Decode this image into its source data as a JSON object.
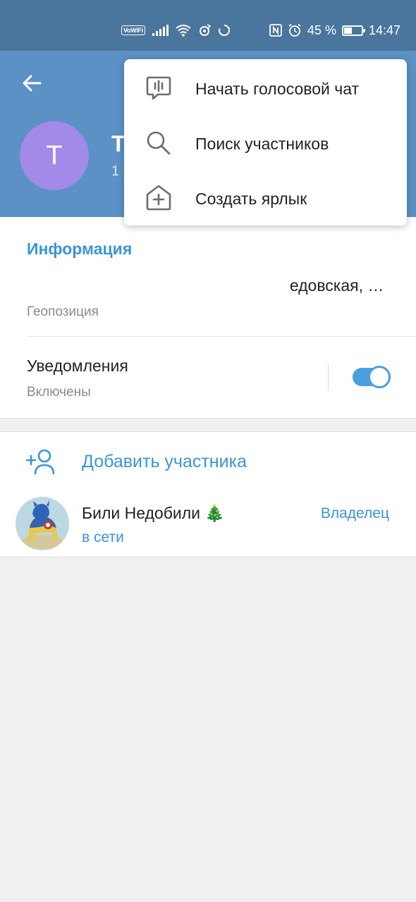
{
  "status_bar": {
    "vowifi": "VoWiFi",
    "nfc": "N",
    "battery_percent": "45 %",
    "battery_level": 0.45,
    "time": "14:47"
  },
  "header": {
    "title_visible": "T",
    "subtitle_visible": "1",
    "avatar_letter": "T",
    "avatar_color": "#a28ae8",
    "background_color": "#5b91c5"
  },
  "menu": {
    "items": [
      {
        "label": "Начать голосовой чат",
        "icon": "voice-chat-icon"
      },
      {
        "label": "Поиск участников",
        "icon": "search-icon"
      },
      {
        "label": "Создать ярлык",
        "icon": "add-shortcut-icon"
      }
    ]
  },
  "info": {
    "section_title": "Информация",
    "geo_value": "едовская, Центральный...",
    "geo_label": "Геопозиция",
    "notifications_title": "Уведомления",
    "notifications_status": "Включены",
    "notifications_enabled": true
  },
  "members": {
    "add_label": "Добавить участника",
    "list": [
      {
        "name": "Били Недобили 🎄",
        "status": "в сети",
        "role": "Владелец"
      }
    ]
  },
  "colors": {
    "accent": "#3a95d5",
    "status_bar": "#4a759d",
    "toggle_on": "#4aa0de"
  }
}
